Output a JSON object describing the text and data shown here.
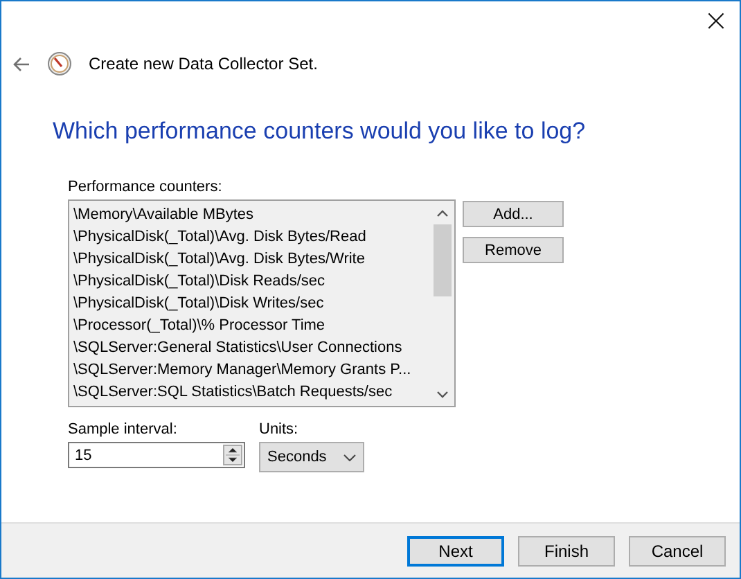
{
  "window": {
    "close": "×"
  },
  "header": {
    "title": "Create new Data Collector Set."
  },
  "heading": "Which performance counters would you like to log?",
  "counters": {
    "label": "Performance counters:",
    "items": [
      "\\Memory\\Available MBytes",
      "\\PhysicalDisk(_Total)\\Avg. Disk Bytes/Read",
      "\\PhysicalDisk(_Total)\\Avg. Disk Bytes/Write",
      "\\PhysicalDisk(_Total)\\Disk Reads/sec",
      "\\PhysicalDisk(_Total)\\Disk Writes/sec",
      "\\Processor(_Total)\\% Processor Time",
      "\\SQLServer:General Statistics\\User Connections",
      "\\SQLServer:Memory Manager\\Memory Grants P...",
      "\\SQLServer:SQL Statistics\\Batch Requests/sec"
    ],
    "buttons": [
      "Add...",
      "Remove"
    ]
  },
  "sample_interval": {
    "label": "Sample interval:",
    "value": "15"
  },
  "units": {
    "label": "Units:",
    "value": "Seconds"
  },
  "footer_buttons": [
    {
      "label": "Next",
      "default": true
    },
    {
      "label": "Finish",
      "default": false
    },
    {
      "label": "Cancel",
      "default": false
    }
  ]
}
